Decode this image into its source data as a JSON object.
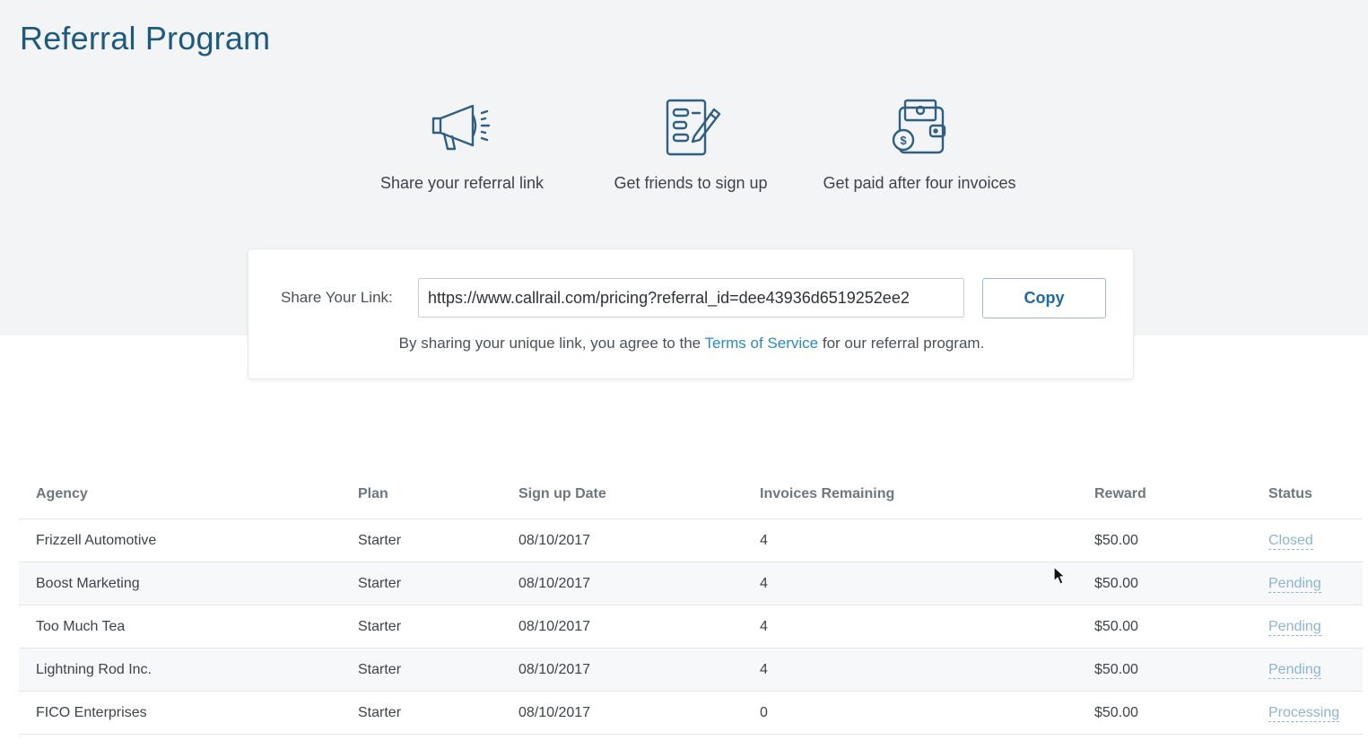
{
  "page": {
    "title": "Referral Program"
  },
  "steps": [
    {
      "icon": "megaphone-icon",
      "label": "Share your referral link"
    },
    {
      "icon": "signup-form-icon",
      "label": "Get friends to sign up"
    },
    {
      "icon": "wallet-money-icon",
      "label": "Get paid after four invoices"
    }
  ],
  "share": {
    "label": "Share Your Link:",
    "link_value": "https://www.callrail.com/pricing?referral_id=dee43936d6519252ee2",
    "copy_label": "Copy",
    "terms_prefix": "By sharing your unique link, you agree to the ",
    "terms_link": "Terms of Service",
    "terms_suffix": " for our referral program."
  },
  "table": {
    "columns": [
      "Agency",
      "Plan",
      "Sign up Date",
      "Invoices Remaining",
      "Reward",
      "Status"
    ],
    "rows": [
      {
        "agency": "Frizzell Automotive",
        "plan": "Starter",
        "date": "08/10/2017",
        "invoices": "4",
        "reward": "$50.00",
        "status": "Closed"
      },
      {
        "agency": "Boost Marketing",
        "plan": "Starter",
        "date": "08/10/2017",
        "invoices": "4",
        "reward": "$50.00",
        "status": "Pending"
      },
      {
        "agency": "Too Much Tea",
        "plan": "Starter",
        "date": "08/10/2017",
        "invoices": "4",
        "reward": "$50.00",
        "status": "Pending"
      },
      {
        "agency": "Lightning Rod Inc.",
        "plan": "Starter",
        "date": "08/10/2017",
        "invoices": "4",
        "reward": "$50.00",
        "status": "Pending"
      },
      {
        "agency": "FICO Enterprises",
        "plan": "Starter",
        "date": "08/10/2017",
        "invoices": "0",
        "reward": "$50.00",
        "status": "Processing"
      }
    ]
  },
  "colors": {
    "title": "#1d5a80",
    "icon_stroke": "#2f5f82",
    "link": "#2a8ac4",
    "status_link": "#8cb4d3",
    "band_bg": "#f3f4f5"
  }
}
